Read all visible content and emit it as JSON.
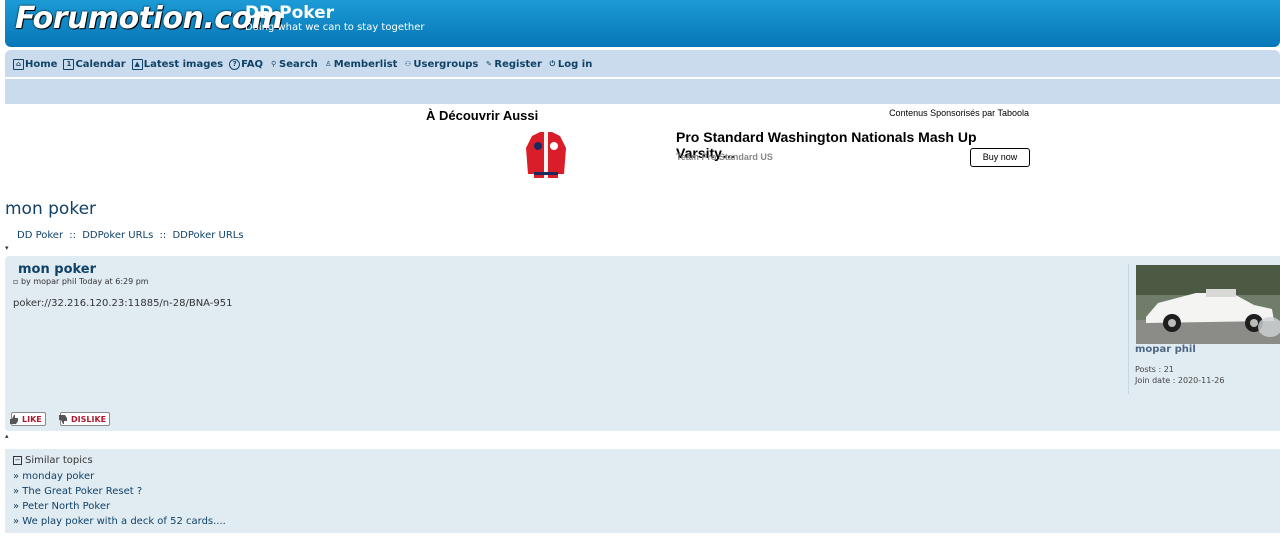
{
  "header": {
    "logo": "Forumotion.com",
    "site_title": "DD Poker",
    "site_description": "Doing what we can to stay together"
  },
  "nav": [
    {
      "label": "Home",
      "icon": "home-icon"
    },
    {
      "label": "Calendar",
      "icon": "calendar-icon"
    },
    {
      "label": "Latest images",
      "icon": "image-icon"
    },
    {
      "label": "FAQ",
      "icon": "help-icon"
    },
    {
      "label": "Search",
      "icon": "search-icon"
    },
    {
      "label": "Memberlist",
      "icon": "user-icon"
    },
    {
      "label": "Usergroups",
      "icon": "group-icon"
    },
    {
      "label": "Register",
      "icon": "register-icon"
    },
    {
      "label": "Log in",
      "icon": "power-icon"
    }
  ],
  "ad": {
    "heading": "À Découvrir Aussi",
    "sponsor": "Contenus Sponsorisés par Taboola",
    "title": "Pro Standard Washington Nationals Mash Up Varsity…",
    "source": "Team Pro Standard US",
    "button": "Buy now"
  },
  "page_title": "mon poker",
  "breadcrumb": [
    "DD Poker",
    "DDPoker URLs",
    "DDPoker URLs"
  ],
  "breadcrumb_sep": "::",
  "post": {
    "title": "mon poker",
    "meta": "by mopar phil Today at 6:29 pm",
    "body": "poker://32.216.120.23:11885/n-28/BNA-951",
    "author": "mopar phil",
    "posts": "Posts : 21",
    "join_date": "Join date : 2020-11-26",
    "like": "LIKE",
    "dislike": "DISLIKE"
  },
  "similar": {
    "heading": "Similar topics",
    "items": [
      "» monday poker",
      "» The Great Poker Reset ?",
      "» Peter North Poker",
      "» We play poker with a deck of 52 cards...."
    ]
  },
  "colors": {
    "header_blue": "#0d88c8",
    "nav_bg": "#c9dbec",
    "post_bg": "#e1ebf2",
    "link": "#104268",
    "vote_red": "#b0182e"
  }
}
